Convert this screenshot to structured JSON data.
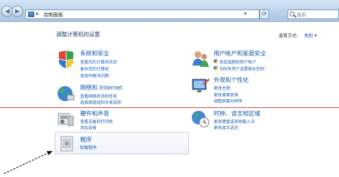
{
  "addressbar": {
    "crumb": "控制面板",
    "sep": "▸",
    "dropdown": "▾"
  },
  "search": {
    "placeholder": "搜索"
  },
  "nav": {
    "back": "◀",
    "forward": "▶",
    "refresh": "⟳"
  },
  "main": {
    "title": "调整计算机的设置",
    "view_by_label": "查看方式:",
    "view_by_value": "类别"
  },
  "categories": [
    {
      "title": "系统和安全",
      "links": [
        "查看您的计算机状态",
        "备份您的计算机",
        "查找并解决问题"
      ]
    },
    {
      "title": "网络和 Internet",
      "links": [
        "查看网络状态和任务",
        "选择家庭组和共享选项"
      ]
    },
    {
      "title": "硬件和声音",
      "links": [
        "查看设备和打印机",
        "添加设备"
      ]
    },
    {
      "title": "程序",
      "links": [
        "卸载程序"
      ]
    },
    {
      "title": "用户帐户和家庭安全",
      "links": [
        "添加或删除用户帐户",
        "为所有用户设置家长控制"
      ]
    },
    {
      "title": "外观和个性化",
      "links": [
        "更改主题",
        "更改桌面背景",
        "调整屏幕分辨率"
      ]
    },
    {
      "title": "时钟、语言和区域",
      "links": [
        "更改键盘或其他输入法",
        "更改显示语言"
      ]
    }
  ],
  "colors": {
    "link": "#1a5fb4",
    "category_title": "#0b57a6",
    "annotation_line": "#d64242"
  }
}
